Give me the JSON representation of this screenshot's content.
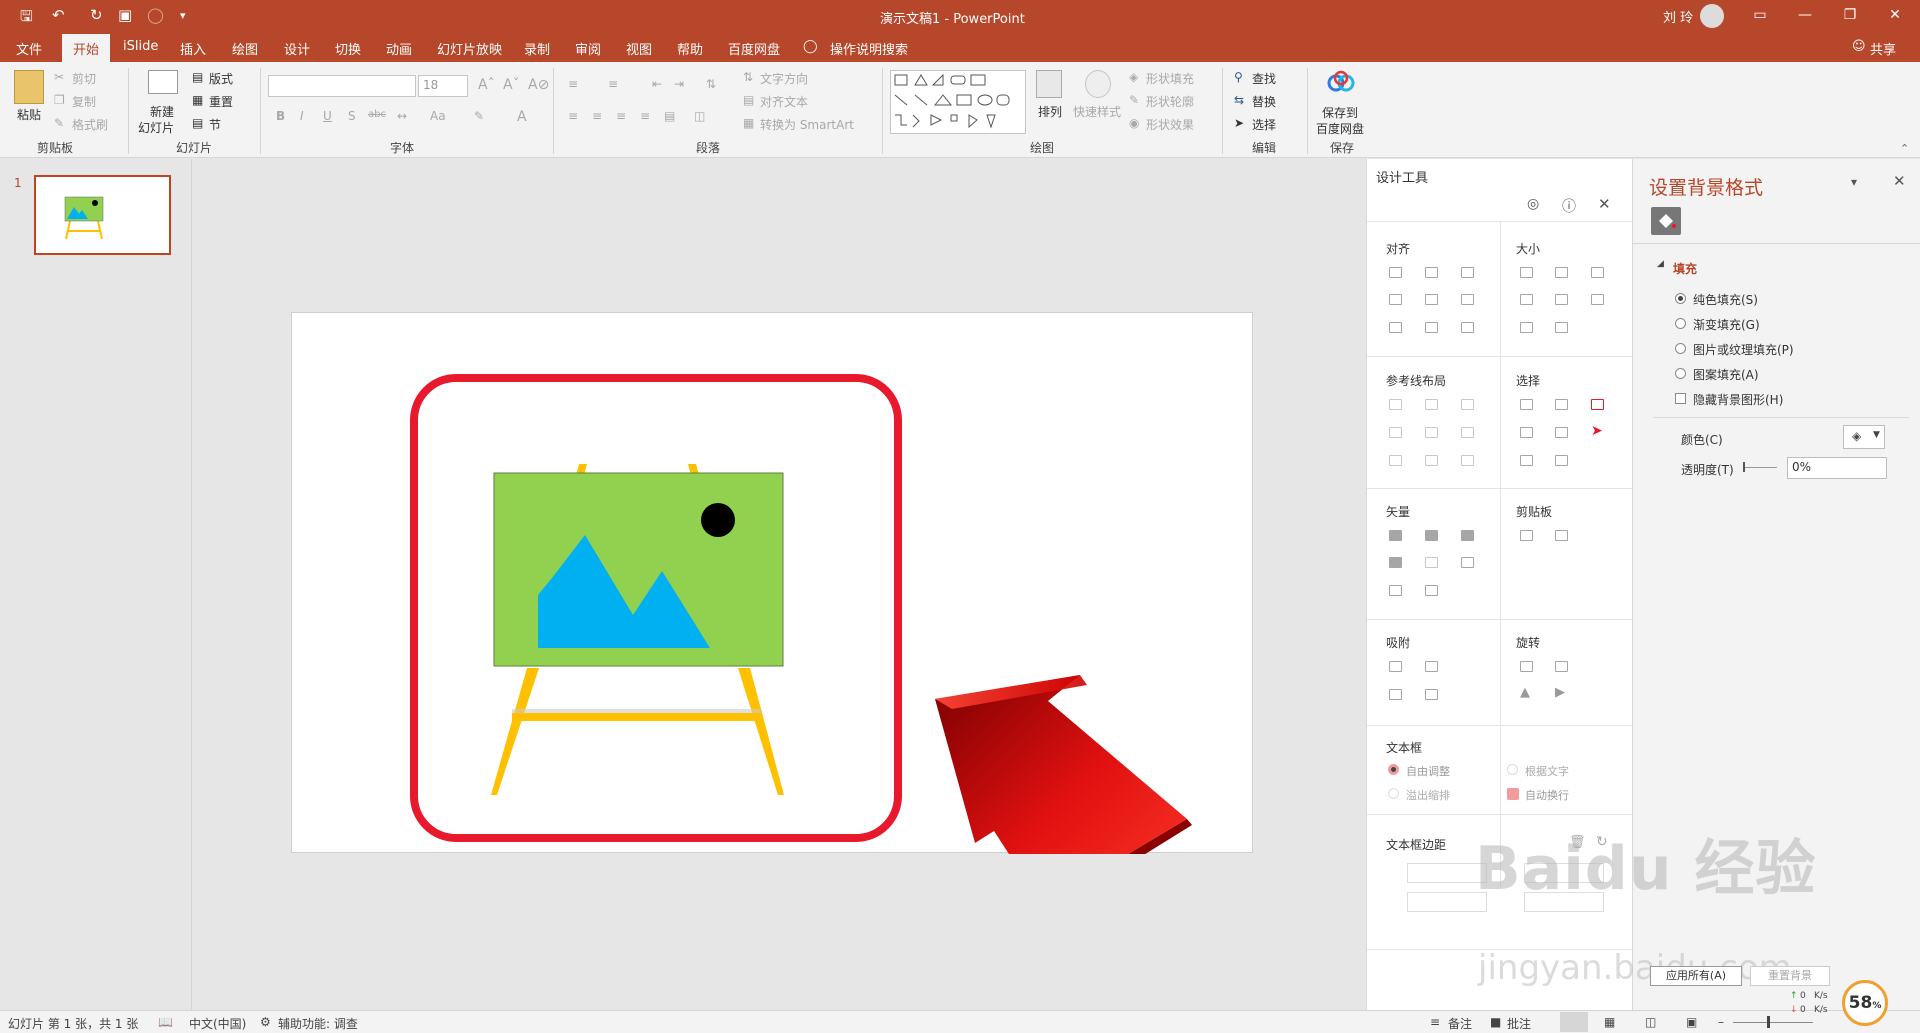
{
  "titlebar": {
    "doc_title": "演示文稿1  -  PowerPoint",
    "user_name": "刘 玲",
    "minimize": "—",
    "restore": "❐",
    "close": "✕",
    "ribbon_display": "▭"
  },
  "tabs": [
    "文件",
    "开始",
    "iSlide",
    "插入",
    "绘图",
    "设计",
    "切换",
    "动画",
    "幻灯片放映",
    "录制",
    "审阅",
    "视图",
    "帮助",
    "百度网盘"
  ],
  "tell_me": "操作说明搜索",
  "share": "共享",
  "ribbon": {
    "clipboard": {
      "label": "剪贴板",
      "paste": "粘贴",
      "cut": "剪切",
      "copy": "复制",
      "format_painter": "格式刷"
    },
    "slides": {
      "label": "幻灯片",
      "new_slide_1": "新建",
      "new_slide_2": "幻灯片",
      "layout": "版式",
      "reset": "重置",
      "section": "节"
    },
    "font": {
      "label": "字体",
      "font_size": "18"
    },
    "paragraph": {
      "label": "段落",
      "text_direction": "文字方向",
      "align_text": "对齐文本",
      "smartart": "转换为 SmartArt"
    },
    "drawing": {
      "label": "绘图",
      "arrange": "排列",
      "quick_styles": "快速样式",
      "shape_fill": "形状填充",
      "shape_outline": "形状轮廓",
      "shape_effects": "形状效果"
    },
    "editing": {
      "label": "编辑",
      "find": "查找",
      "replace": "替换",
      "select": "选择"
    },
    "save": {
      "label": "保存",
      "save_1": "保存到",
      "save_2": "百度网盘"
    }
  },
  "thumbnail": {
    "number": "1"
  },
  "design_tools": {
    "title": "设计工具",
    "sections": {
      "align": "对齐",
      "size": "大小",
      "guides": "参考线布局",
      "select": "选择",
      "vector": "矢量",
      "clipboard": "剪贴板",
      "snap": "吸附",
      "rotate": "旋转",
      "textbox": "文本框",
      "textbox_margin": "文本框边距"
    },
    "textbox_options": {
      "auto_fit": "自由调整",
      "fit_text": "根据文字",
      "overflow": "溢出缩排",
      "auto_wrap": "自动换行"
    },
    "buttons": {
      "apply_all": "应用所有(A)",
      "reset": "重置背景"
    }
  },
  "format_pane": {
    "title": "设置背景格式",
    "section": "填充",
    "options": [
      "纯色填充(S)",
      "渐变填充(G)",
      "图片或纹理填充(P)",
      "图案填充(A)"
    ],
    "hide_bg": "隐藏背景图形(H)",
    "color_label": "颜色(C)",
    "transparency_label": "透明度(T)",
    "transparency_value": "0%"
  },
  "statusbar": {
    "slide_info": "幻灯片 第 1 张，共 1 张",
    "language": "中文(中国)",
    "accessibility": "辅助功能: 调查",
    "notes": "备注",
    "comments": "批注",
    "net_up": "0",
    "net_down": "0",
    "net_unit": "K/s",
    "percent": "58"
  },
  "watermark": {
    "brand": "Baidu 经验",
    "url": "jingyan.baidu.com"
  },
  "colors": {
    "accent": "#b7472a",
    "canvas_green": "#92d050",
    "mountain_blue": "#00b0f0",
    "easel_yellow": "#ffc000",
    "highlight_red": "#e8192c"
  }
}
